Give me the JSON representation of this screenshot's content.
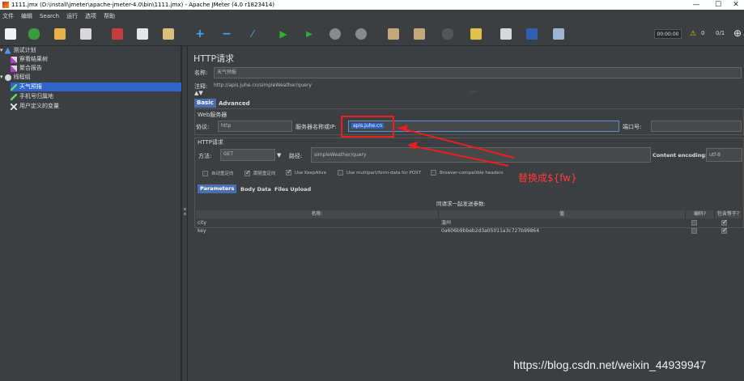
{
  "window": {
    "title": "1111.jmx (D:\\install\\jmeter\\apache-jmeter-4.0\\bin\\1111.jmx) - Apache JMeter (4.0 r1823414)",
    "minimize": "—",
    "maximize": "☐",
    "close": "✕"
  },
  "menu": [
    "文件",
    "编辑",
    "Search",
    "运行",
    "选项",
    "帮助"
  ],
  "toolbar": {
    "timer": "00:00:00",
    "warning_count": "0",
    "threads": "0/1"
  },
  "tree": [
    {
      "label": "测试计划",
      "icon": "test-plan-icon"
    },
    {
      "label": "察看结果树",
      "icon": "results-tree-icon"
    },
    {
      "label": "聚合报告",
      "icon": "aggregate-report-icon"
    },
    {
      "label": "线程组",
      "icon": "thread-group-icon"
    },
    {
      "label": "天气预报",
      "icon": "http-sampler-icon"
    },
    {
      "label": "手机号归属地",
      "icon": "http-sampler-icon"
    },
    {
      "label": "用户定义的变量",
      "icon": "variables-icon"
    }
  ],
  "panel": {
    "header": "HTTP请求",
    "name_label": "名称:",
    "name_value": "天气预报",
    "comment_label": "注释:",
    "comment_value": "http://apis.juhe.cn/simpleWeather/query",
    "tabs": [
      "Basic",
      "Advanced"
    ],
    "web_server_title": "Web服务器",
    "protocol_label": "协议:",
    "protocol_value": "http",
    "server_label": "服务器名称或IP:",
    "server_value": "apis.juhe.cn",
    "port_label": "端口号:",
    "port_value": "",
    "http_request_title": "HTTP请求",
    "method_label": "方法:",
    "method_value": "GET",
    "path_label": "路径:",
    "path_value": "simpleWeather/query",
    "encoding_label": "Content encoding:",
    "encoding_value": "utf-8",
    "options": [
      {
        "label": "自动重定向",
        "checked": false
      },
      {
        "label": "跟随重定向",
        "checked": true
      },
      {
        "label": "Use KeepAlive",
        "checked": true
      },
      {
        "label": "Use multipart/form-data for POST",
        "checked": false
      },
      {
        "label": "Browser-compatible headers",
        "checked": false
      }
    ],
    "param_tabs": [
      "Parameters",
      "Body Data",
      "Files Upload"
    ],
    "table_caption": "同请求一起发送参数:",
    "columns": [
      "名称:",
      "值",
      "编码?",
      "包含等于?"
    ],
    "rows": [
      {
        "name": "city",
        "value": "温州",
        "encode": false,
        "include_equals": true
      },
      {
        "name": "key",
        "value": "0a606b9bbeb2d3a05011a3c727b99864",
        "encode": false,
        "include_equals": true
      }
    ]
  },
  "annotation": {
    "text": "替换成${fw}",
    "color": "#ee1c1c"
  },
  "watermark": "https://blog.csdn.net/weixin_44939947"
}
